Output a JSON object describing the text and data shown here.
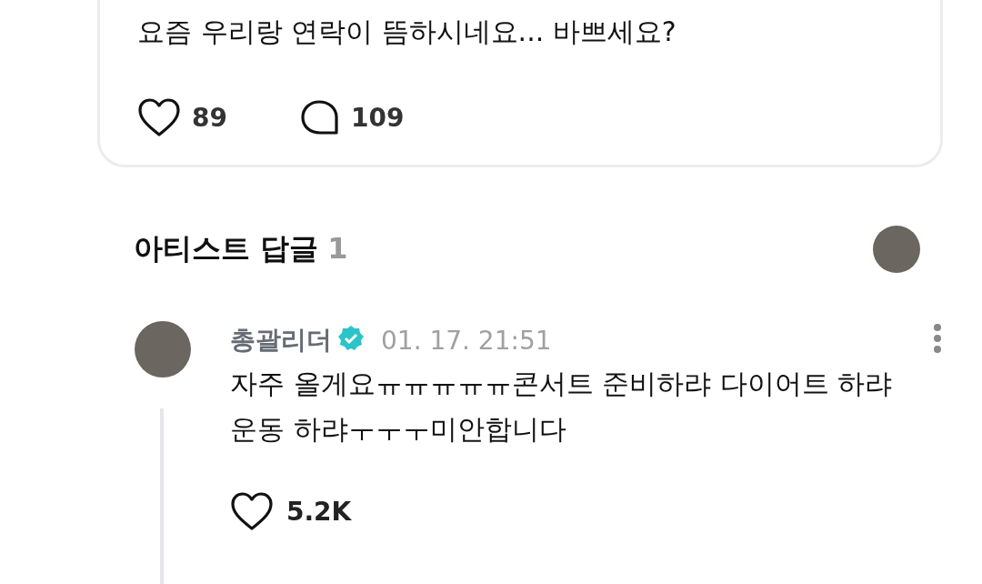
{
  "post": {
    "text": "요즘 우리랑 연락이 뜸하시네요... 바쁘세요?",
    "likes": "89",
    "comments": "109"
  },
  "replies": {
    "title": "아티스트 답글",
    "count": "1",
    "items": [
      {
        "author": "총괄리더",
        "verified": true,
        "time": "01. 17. 21:51",
        "text": "자주 올게요ㅠㅠㅠㅠㅠ콘서트 준비하랴 다이어트 하랴 운동 하랴ㅜㅜㅜ미안합니다",
        "likes": "5.2K"
      }
    ]
  }
}
